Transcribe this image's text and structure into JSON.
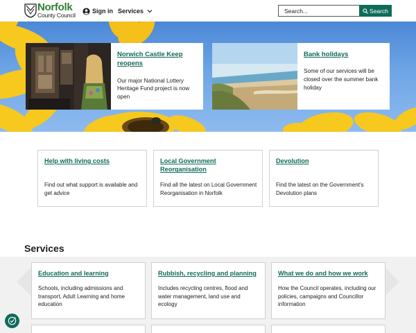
{
  "header": {
    "logo_name": "Norfolk",
    "logo_sub": "County Council",
    "signin_label": "Sign in",
    "services_label": "Services",
    "search_placeholder": "Search...",
    "search_button": "Search"
  },
  "hero": {
    "cards": [
      {
        "title": "Norwich Castle Keep reopens",
        "desc": "Our major National Lottery Heritage Fund project is now open"
      },
      {
        "title": "Bank holidays",
        "desc": "Some of our services will be closed over the summer bank holiday"
      }
    ]
  },
  "info_cards": [
    {
      "title": "Help with living costs",
      "desc": "Find out what support is available and get advice"
    },
    {
      "title": "Local Government Reorganisation",
      "desc": "Find all the latest on Local Government Reorganisation in Norfolk"
    },
    {
      "title": "Devolution",
      "desc": "Find the latest on the Government's Devolution plans"
    }
  ],
  "services": {
    "heading": "Services",
    "cards": [
      {
        "title": "Education and learning",
        "desc": "Schools, including admissions and transport, Adult Learning and home education"
      },
      {
        "title": "Rubbish, recycling and planning",
        "desc": "Includes recycling centres, flood and water management, land use and ecology"
      },
      {
        "title": "What we do and how we work",
        "desc": "How the Council operates, including our policies, campaigns and Councillor information"
      }
    ]
  },
  "colors": {
    "accent": "#0f6b5a",
    "logo_green": "#2e7d32",
    "sky": "#6ea5e6",
    "sunflower": "#f7c81e"
  },
  "icons": {
    "user": "user-circle-icon",
    "chevron": "chevron-down-icon",
    "search": "search-icon",
    "cookie": "cookie-settings-icon"
  }
}
